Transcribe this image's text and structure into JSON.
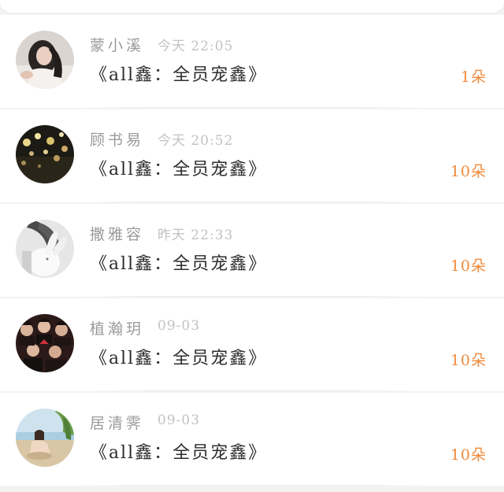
{
  "rows": [
    {
      "name": "蒙小溪",
      "time": "今天 22:05",
      "title": "《all鑫：全员宠鑫》",
      "count": "1朵",
      "avatar": "portrait-girl-avatar"
    },
    {
      "name": "顾书易",
      "time": "今天 20:52",
      "title": "《all鑫：全员宠鑫》",
      "count": "10朵",
      "avatar": "night-lights-avatar"
    },
    {
      "name": "撒雅容",
      "time": "昨天 22:33",
      "title": "《all鑫：全员宠鑫》",
      "count": "10朵",
      "avatar": "girl-with-plush-bunny-avatar"
    },
    {
      "name": "植瀚玥",
      "time": "09-03",
      "title": "《all鑫：全员宠鑫》",
      "count": "10朵",
      "avatar": "group-photo-avatar"
    },
    {
      "name": "居清霁",
      "time": "09-03",
      "title": "《all鑫：全员宠鑫》",
      "count": "10朵",
      "avatar": "beach-girl-avatar"
    }
  ],
  "colors": {
    "name": "#9a9a9a",
    "time": "#c2c2c2",
    "title": "#2d2d2d",
    "count": "#f08a3c",
    "background": "#f3f3f3"
  }
}
